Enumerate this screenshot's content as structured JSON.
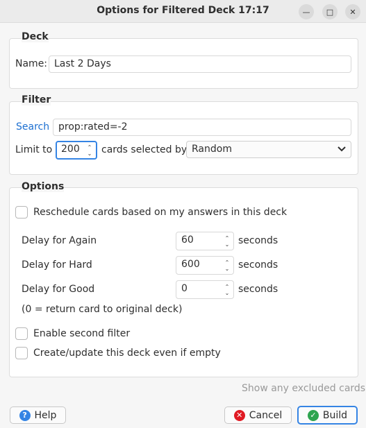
{
  "window": {
    "title": "Options for Filtered Deck 17:17",
    "controls": [
      "minimize-icon",
      "maximize-icon",
      "close-icon"
    ]
  },
  "deck": {
    "heading": "Deck",
    "name_label": "Name:",
    "name_value": "Last 2 Days"
  },
  "filter": {
    "heading": "Filter",
    "search_link": "Search",
    "search_value": "prop:rated=-2",
    "limit_label": "Limit to",
    "limit_value": "200",
    "cards_selected_label": "cards selected by",
    "order_value": "Random"
  },
  "options": {
    "heading": "Options",
    "reschedule_label": "Reschedule cards based on my answers in this deck",
    "reschedule_checked": false,
    "delays": [
      {
        "label": "Delay for Again",
        "value": "60",
        "unit": "seconds"
      },
      {
        "label": "Delay for Hard",
        "value": "600",
        "unit": "seconds"
      },
      {
        "label": "Delay for Good",
        "value": "0",
        "unit": "seconds"
      }
    ],
    "delay_note": "(0 = return card to original deck)",
    "second_filter_label": "Enable second filter",
    "second_filter_checked": false,
    "create_empty_label": "Create/update this deck even if empty",
    "create_empty_checked": false
  },
  "show_excluded_label": "Show any excluded cards",
  "buttons": {
    "help": "Help",
    "cancel": "Cancel",
    "build": "Build"
  },
  "colors": {
    "accent": "#3584e4",
    "link": "#1c6fd1",
    "help_icon": "#3584e4",
    "cancel_icon": "#e01b24",
    "build_icon": "#2ea44f"
  }
}
